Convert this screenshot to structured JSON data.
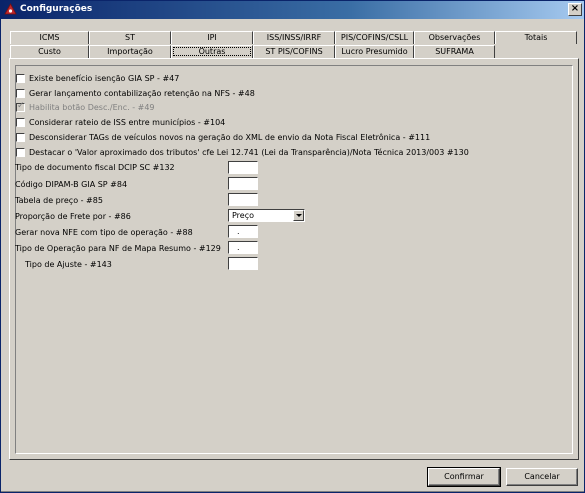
{
  "window": {
    "title": "Configurações"
  },
  "tabs_row1": [
    {
      "label": "ICMS"
    },
    {
      "label": "ST"
    },
    {
      "label": "IPI"
    },
    {
      "label": "ISS/INSS/IRRF"
    },
    {
      "label": "PIS/COFINS/CSLL"
    },
    {
      "label": "Observações"
    },
    {
      "label": "Totais"
    }
  ],
  "tabs_row2": [
    {
      "label": "Custo"
    },
    {
      "label": "Importação"
    },
    {
      "label": "Outras"
    },
    {
      "label": "ST PIS/COFINS"
    },
    {
      "label": "Lucro Presumido"
    },
    {
      "label": "SUFRAMA"
    }
  ],
  "active_tab": "Outras",
  "checkboxes": [
    {
      "label": "Existe benefício isenção GIA SP - #47",
      "checked": false,
      "enabled": true
    },
    {
      "label": "Gerar lançamento contabilização retenção na NFS - #48",
      "checked": false,
      "enabled": true
    },
    {
      "label": "Habilita botão Desc./Enc. - #49",
      "checked": true,
      "enabled": false
    },
    {
      "label": "Considerar rateio de ISS entre municípios - #104",
      "checked": false,
      "enabled": true
    },
    {
      "label": "Desconsiderar TAGs de veículos novos na geração do XML de envio da Nota Fiscal Eletrônica - #111",
      "checked": false,
      "enabled": true
    },
    {
      "label": "Destacar o 'Valor aproximado dos tributos' cfe Lei 12.741 (Lei da Transparência)/Nota Técnica 2013/003 #130",
      "checked": false,
      "enabled": true
    }
  ],
  "fields": [
    {
      "label": "Tipo de documento fiscal DCIP SC #132",
      "value": ""
    },
    {
      "label": "Código DIPAM-B GIA SP  #84",
      "value": ""
    },
    {
      "label": "Tabela de preço - #85",
      "value": ""
    },
    {
      "label": "Proporção de Frete por - #86",
      "value": "Preço"
    },
    {
      "label": "Gerar nova NFE com tipo de operação - #88",
      "value": "."
    },
    {
      "label": "Tipo de Operação para NF de Mapa Resumo - #129",
      "value": "."
    },
    {
      "label": "Tipo de Ajuste - #143",
      "value": ""
    }
  ],
  "buttons": {
    "confirm": "Confirmar",
    "cancel": "Cancelar"
  }
}
